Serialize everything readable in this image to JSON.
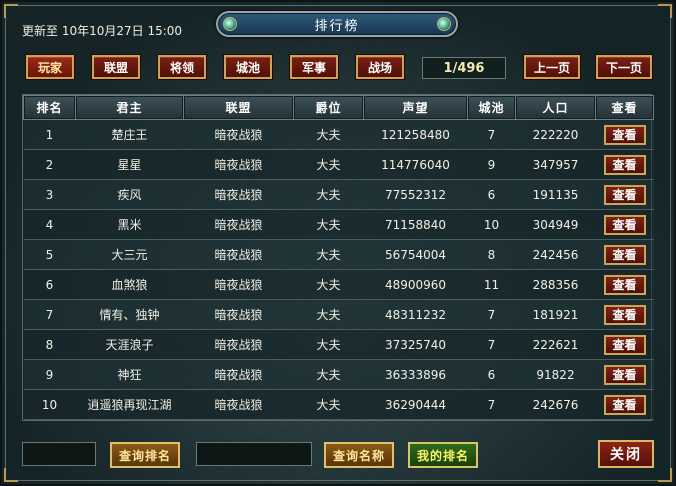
{
  "header": {
    "update_info": "更新至 10年10月27日 15:00",
    "title": "排行榜"
  },
  "tabs": [
    {
      "label": "玩家",
      "active": true
    },
    {
      "label": "联盟",
      "active": false
    },
    {
      "label": "将领",
      "active": false
    },
    {
      "label": "城池",
      "active": false
    },
    {
      "label": "军事",
      "active": false
    },
    {
      "label": "战场",
      "active": false
    }
  ],
  "pagination": {
    "indicator": "1/496",
    "prev_label": "上一页",
    "next_label": "下一页"
  },
  "table": {
    "columns": [
      "排名",
      "君主",
      "联盟",
      "爵位",
      "声望",
      "城池",
      "人口",
      "查看"
    ],
    "view_label": "查看",
    "rows": [
      {
        "rank": "1",
        "lord": "楚庄王",
        "alliance": "暗夜战狼",
        "title": "大夫",
        "prestige": "121258480",
        "cities": "7",
        "population": "222220"
      },
      {
        "rank": "2",
        "lord": "星星",
        "alliance": "暗夜战狼",
        "title": "大夫",
        "prestige": "114776040",
        "cities": "9",
        "population": "347957"
      },
      {
        "rank": "3",
        "lord": "疾风",
        "alliance": "暗夜战狼",
        "title": "大夫",
        "prestige": "77552312",
        "cities": "6",
        "population": "191135"
      },
      {
        "rank": "4",
        "lord": "黑米",
        "alliance": "暗夜战狼",
        "title": "大夫",
        "prestige": "71158840",
        "cities": "10",
        "population": "304949"
      },
      {
        "rank": "5",
        "lord": "大三元",
        "alliance": "暗夜战狼",
        "title": "大夫",
        "prestige": "56754004",
        "cities": "8",
        "population": "242456"
      },
      {
        "rank": "6",
        "lord": "血煞狼",
        "alliance": "暗夜战狼",
        "title": "大夫",
        "prestige": "48900960",
        "cities": "11",
        "population": "288356"
      },
      {
        "rank": "7",
        "lord": "情有、独钟",
        "alliance": "暗夜战狼",
        "title": "大夫",
        "prestige": "48311232",
        "cities": "7",
        "population": "181921"
      },
      {
        "rank": "8",
        "lord": "天涯浪子",
        "alliance": "暗夜战狼",
        "title": "大夫",
        "prestige": "37325740",
        "cities": "7",
        "population": "222621"
      },
      {
        "rank": "9",
        "lord": "神狂",
        "alliance": "暗夜战狼",
        "title": "大夫",
        "prestige": "36333896",
        "cities": "6",
        "population": "91822"
      },
      {
        "rank": "10",
        "lord": "逍遥狼再现江湖",
        "alliance": "暗夜战狼",
        "title": "大夫",
        "prestige": "36290444",
        "cities": "7",
        "population": "242676"
      }
    ]
  },
  "footer": {
    "rank_input_value": "",
    "query_rank_label": "查询排名",
    "name_input_value": "",
    "query_name_label": "查询名称",
    "my_rank_label": "我的排名",
    "close_label": "关闭"
  }
}
